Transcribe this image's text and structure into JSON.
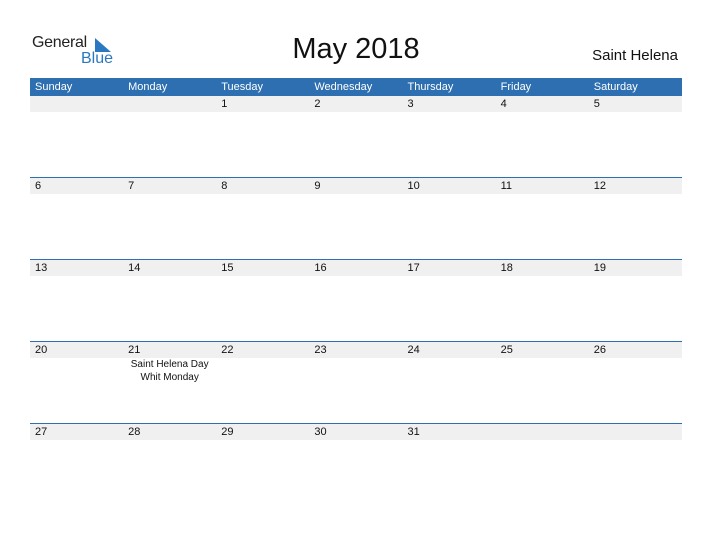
{
  "logo": {
    "text_general": "General",
    "text_blue": "Blue",
    "icon": "triangle-flag-icon"
  },
  "header": {
    "title": "May 2018",
    "country": "Saint Helena"
  },
  "colors": {
    "accent": "#2d6fb0",
    "row_bg": "#f0f0f0",
    "logo_blue": "#2a79c0"
  },
  "weekdays": [
    "Sunday",
    "Monday",
    "Tuesday",
    "Wednesday",
    "Thursday",
    "Friday",
    "Saturday"
  ],
  "weeks": [
    {
      "days": [
        "",
        "",
        "1",
        "2",
        "3",
        "4",
        "5"
      ],
      "events": [
        "",
        "",
        "",
        "",
        "",
        "",
        ""
      ]
    },
    {
      "days": [
        "6",
        "7",
        "8",
        "9",
        "10",
        "11",
        "12"
      ],
      "events": [
        "",
        "",
        "",
        "",
        "",
        "",
        ""
      ]
    },
    {
      "days": [
        "13",
        "14",
        "15",
        "16",
        "17",
        "18",
        "19"
      ],
      "events": [
        "",
        "",
        "",
        "",
        "",
        "",
        ""
      ]
    },
    {
      "days": [
        "20",
        "21",
        "22",
        "23",
        "24",
        "25",
        "26"
      ],
      "events": [
        "",
        "Saint Helena Day\nWhit Monday",
        "",
        "",
        "",
        "",
        ""
      ]
    },
    {
      "days": [
        "27",
        "28",
        "29",
        "30",
        "31",
        "",
        ""
      ],
      "events": [
        "",
        "",
        "",
        "",
        "",
        "",
        ""
      ]
    }
  ]
}
